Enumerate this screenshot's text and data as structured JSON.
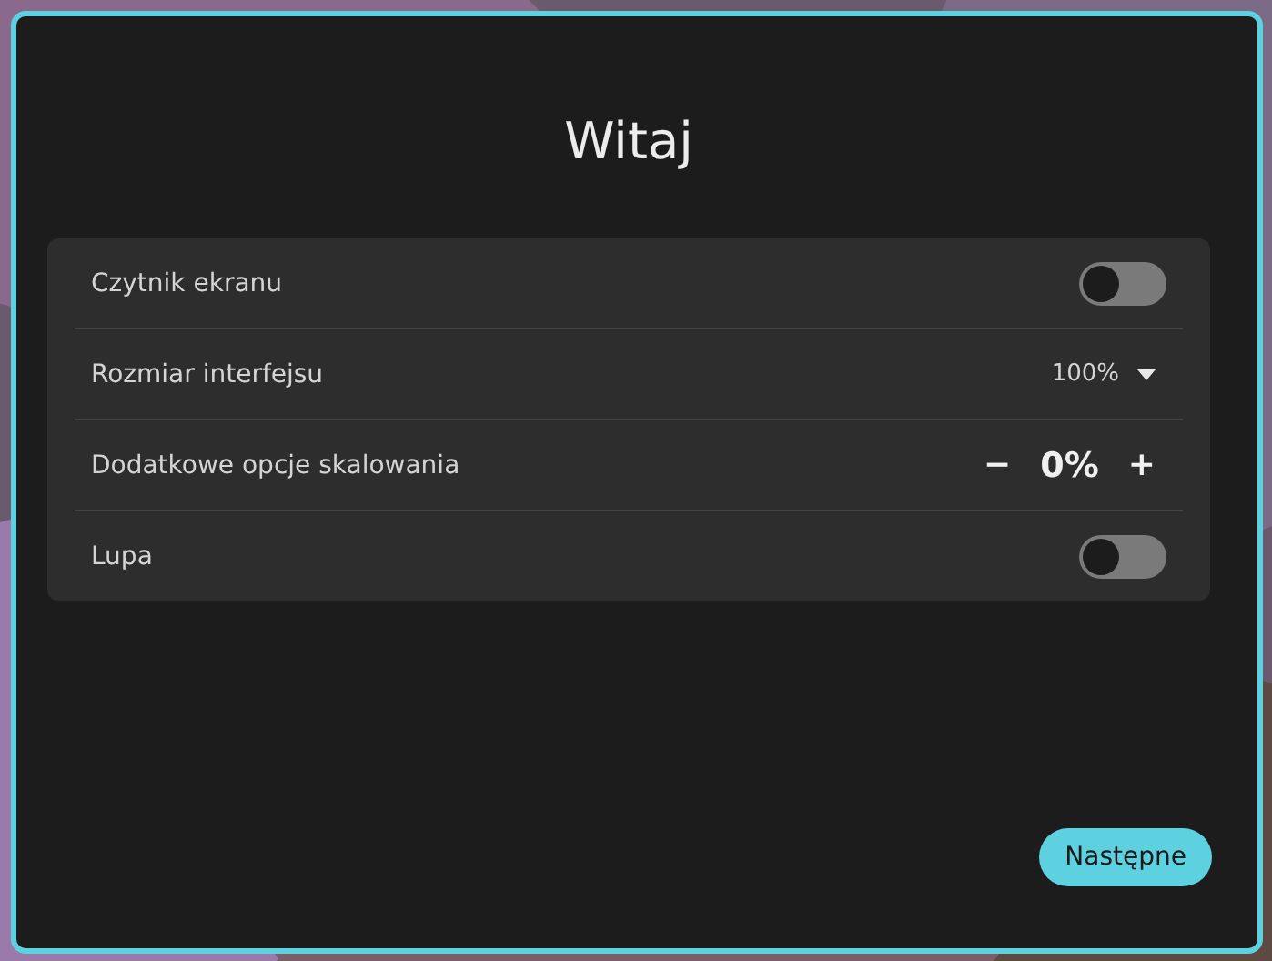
{
  "title": "Witaj",
  "settings": [
    {
      "kind": "toggle",
      "label": "Czytnik ekranu",
      "on": false
    },
    {
      "kind": "dropdown",
      "label": "Rozmiar interfejsu",
      "value": "100%"
    },
    {
      "kind": "stepper",
      "label": "Dodatkowe opcje skalowania",
      "decrement": "−",
      "value": "0%",
      "increment": "+"
    },
    {
      "kind": "toggle",
      "label": "Lupa",
      "on": false
    }
  ],
  "next_button": "Następne"
}
